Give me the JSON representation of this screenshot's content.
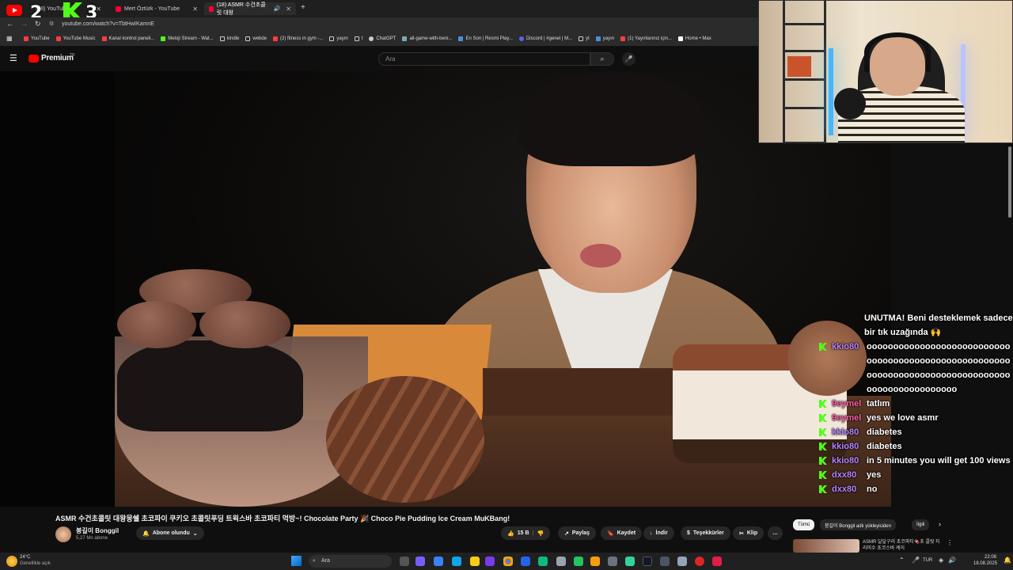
{
  "browser": {
    "tabs": [
      {
        "label": "(18) YouTube"
      },
      {
        "label": "Mert Öztürk - YouTube"
      },
      {
        "label": "(18) ASMR 수건초콜릿 대왕"
      }
    ],
    "new_tab": "+",
    "url": "youtube.com/watch?v=TbtHwIKamnE",
    "overlay_counts": [
      "2",
      "3"
    ],
    "bookmarks": [
      "YouTube",
      "YouTube Music",
      "Kanal kontrol paneli...",
      "Meloji Stream - Wat...",
      "kindle",
      "webde",
      "(2) fitness in gym -...",
      "yayın",
      "t",
      "ChatGPT",
      "all-game-with-beni...",
      "En Son | Resmi Play...",
      "Discord | #genel | M...",
      "yt",
      "yayın",
      "(1) Yayınlarınız için...",
      "Home • Max"
    ]
  },
  "youtube": {
    "logo": "Premium",
    "region": "TR",
    "search_placeholder": "Ara",
    "search_icon": "search-icon",
    "mic_icon": "mic-icon"
  },
  "chat": {
    "intro": "UNUTMA! Beni desteklemek sadece bir tık uzağında 🙌",
    "messages": [
      {
        "user": "kkio80",
        "text": "oooooooooooooooooooooooooooooooooooooooooooooooooooooooooooooooooooooooooooooooooooooooooooooooooo",
        "color": "#b583ff"
      },
      {
        "user": "9eymel",
        "text": "tatlım",
        "color": "#ff5fa2"
      },
      {
        "user": "9eymel",
        "text": "yes we love asmr",
        "color": "#ff5fa2"
      },
      {
        "user": "kkio80",
        "text": "diabetes",
        "color": "#b583ff"
      },
      {
        "user": "kkio80",
        "text": "diabetes",
        "color": "#b583ff"
      },
      {
        "user": "kkio80",
        "text": "in 5 minutes you will get 100 views",
        "color": "#b583ff"
      },
      {
        "user": "dxx80",
        "text": "yes",
        "color": "#b583ff"
      },
      {
        "user": "dxx80",
        "text": "no",
        "color": "#b583ff"
      }
    ]
  },
  "video": {
    "title": "ASMR 수건초콜릿 대왕몽쉘 초코파이 쿠키오 초콜릿푸딩 트윅스바 초코파티 먹방~! Chocolate Party 🎉 Choco Pie Pudding Ice Cream MuKBang!",
    "channel": "붕길이 Bonggil",
    "subscribers": "5,27 Mn abone",
    "subscribe_label": "Abone olundu",
    "likes": "15 B",
    "share": "Paylaş",
    "save": "Kaydet",
    "download": "İndir",
    "thanks": "Teşekkürler",
    "clip": "Klip",
    "more": "…"
  },
  "recommendations": {
    "chips": [
      "Tümü",
      "붕길이 Bonggil adlı yükleyiciden",
      "İlgili"
    ],
    "first_title": "ASMR 달달구리 초코파티🍫초 콜릿 티라미수 초코스바 케이"
  },
  "taskbar": {
    "weather_temp": "24°C",
    "weather_desc": "Genellikle açık",
    "search": "Ara",
    "lang": "TUR",
    "time": "22:08",
    "date": "18.08.2025"
  },
  "colors": {
    "accent": "#ff0000",
    "kick": "#53fc18"
  }
}
